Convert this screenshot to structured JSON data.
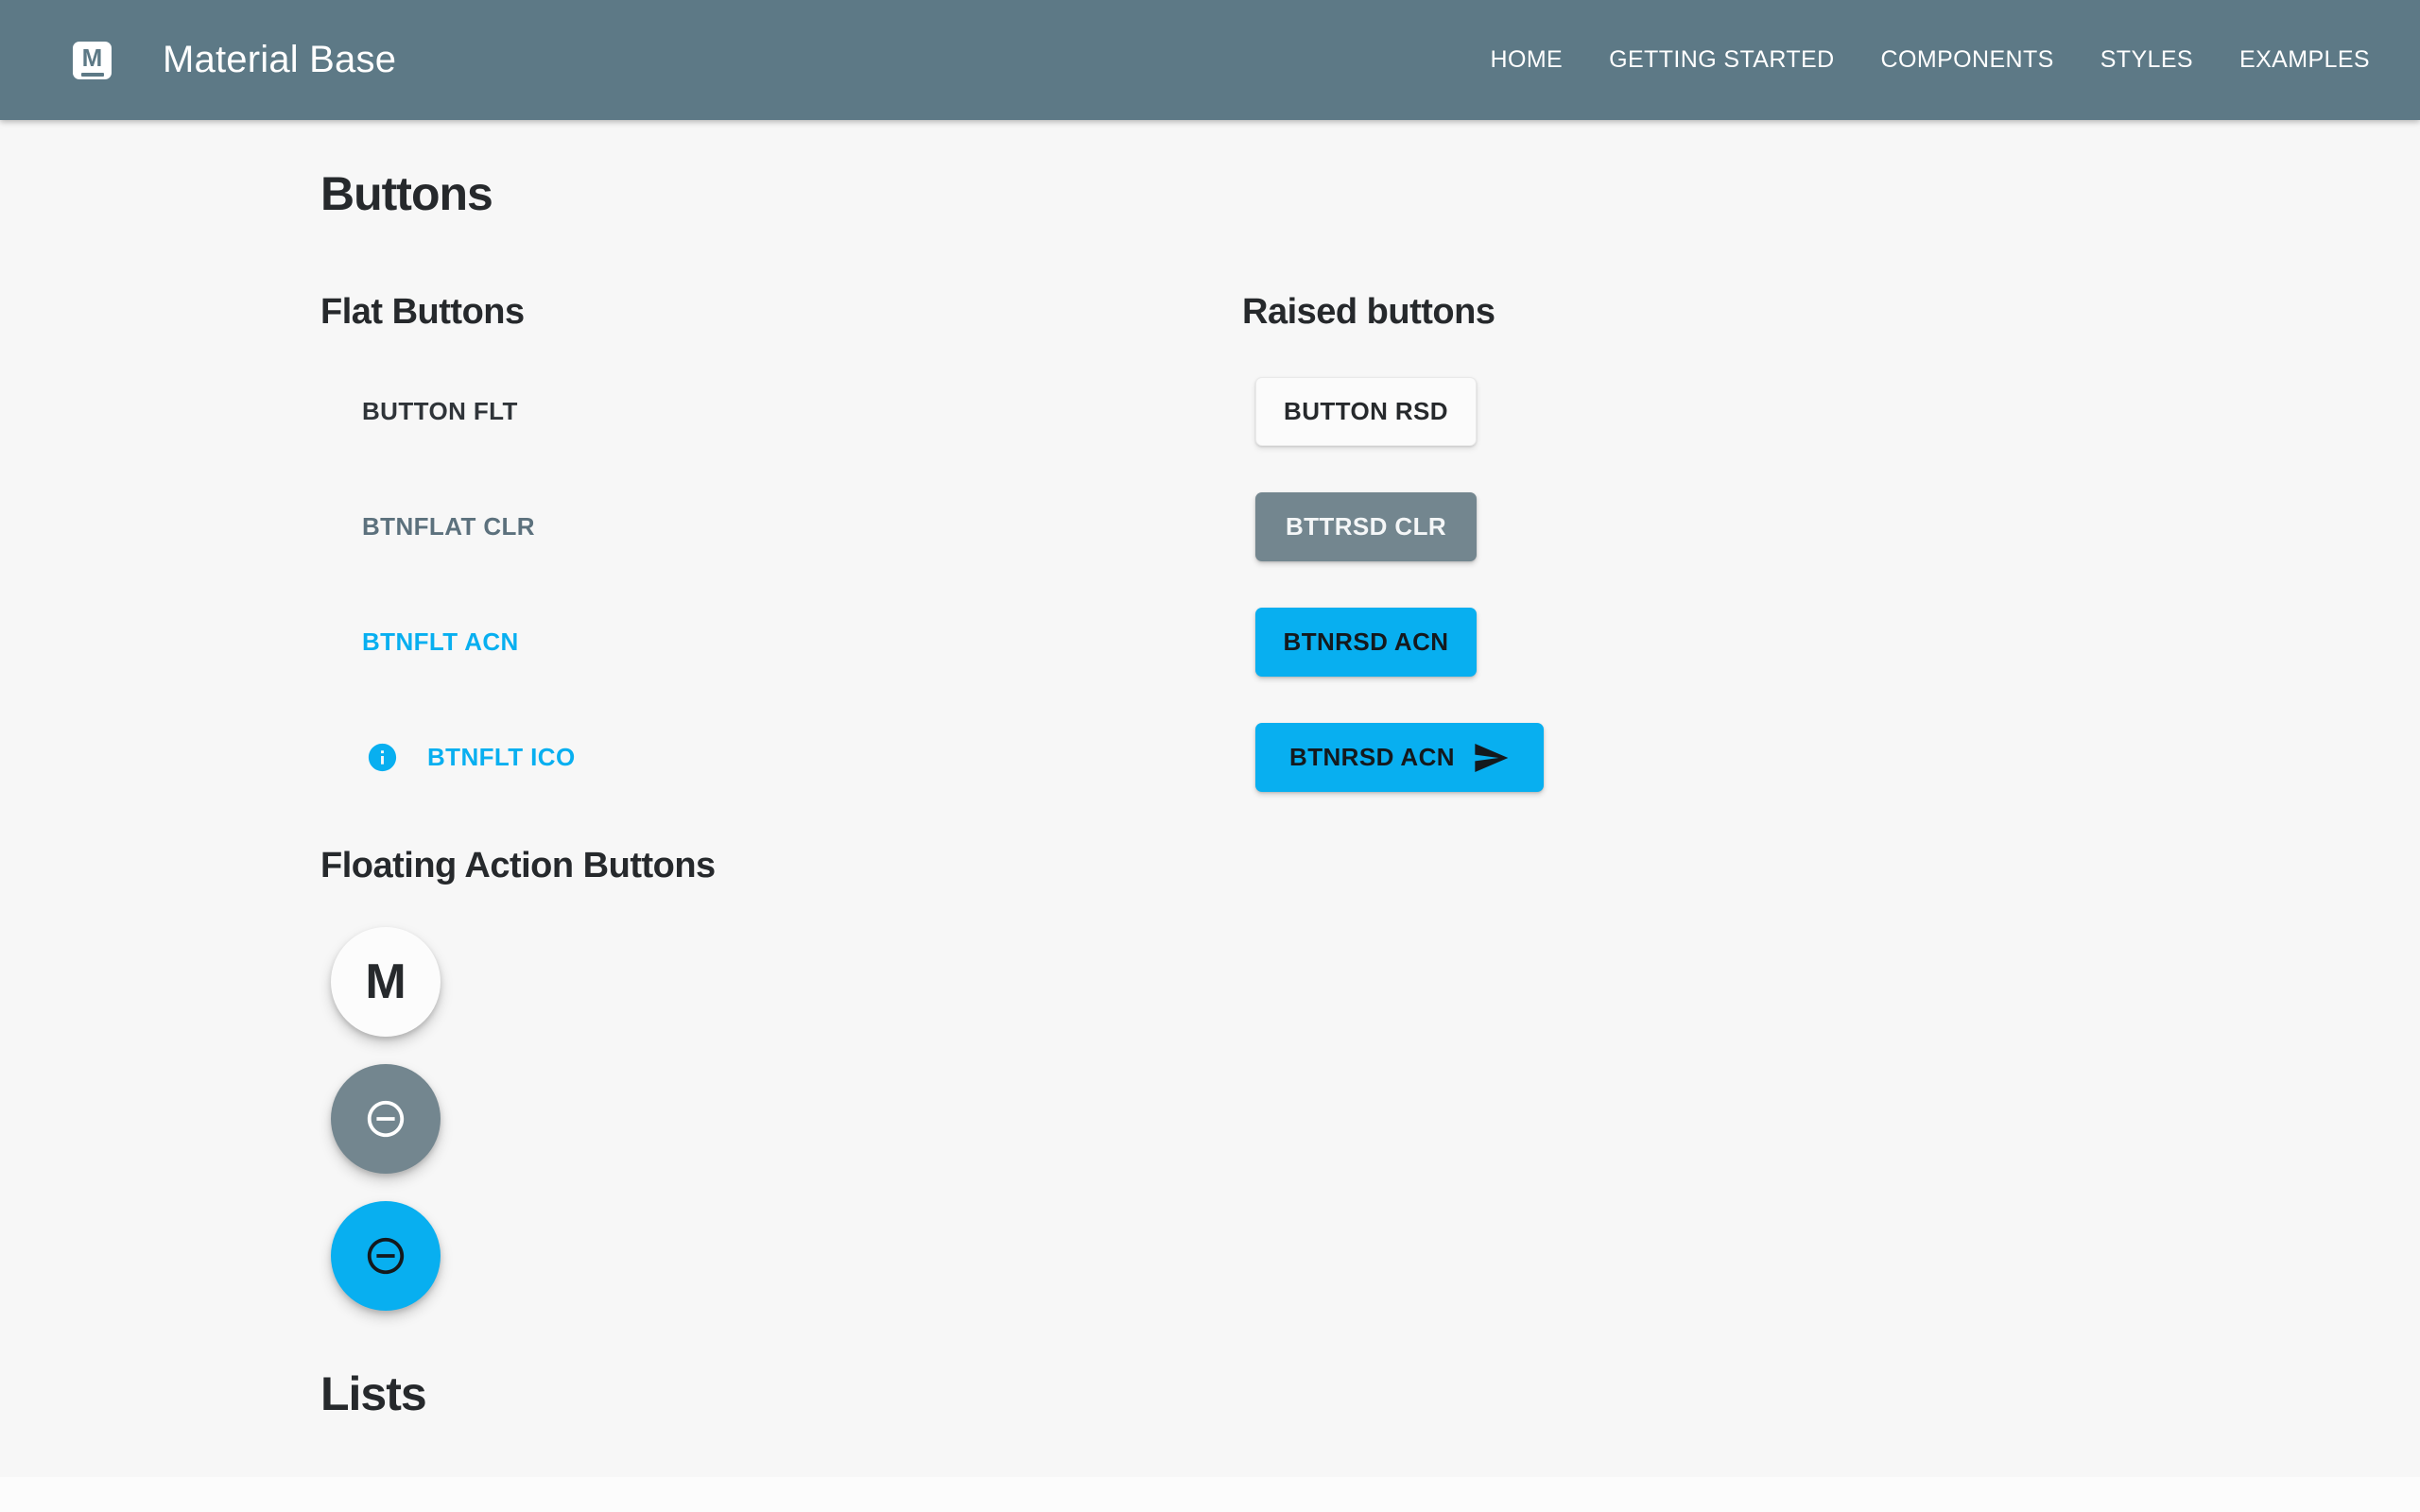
{
  "header": {
    "logo_letter": "M",
    "title": "Material Base",
    "nav": [
      {
        "label": "HOME"
      },
      {
        "label": "GETTING STARTED"
      },
      {
        "label": "COMPONENTS"
      },
      {
        "label": "STYLES"
      },
      {
        "label": "EXAMPLES"
      }
    ]
  },
  "sections": {
    "buttons": {
      "title": "Buttons",
      "flat": {
        "title": "Flat Buttons",
        "items": [
          {
            "label": "BUTTON FLT",
            "variant": "default"
          },
          {
            "label": "BTNFLAT CLR",
            "variant": "colored"
          },
          {
            "label": "BTNFLT ACN",
            "variant": "accent"
          },
          {
            "label": "BTNFLT ICO",
            "variant": "accent",
            "icon": "info-icon"
          }
        ]
      },
      "raised": {
        "title": "Raised buttons",
        "items": [
          {
            "label": "BUTTON RSD",
            "variant": "default"
          },
          {
            "label": "BTTRSD CLR",
            "variant": "colored"
          },
          {
            "label": "BTNRSD ACN",
            "variant": "accent"
          },
          {
            "label": "BTNRSD ACN",
            "variant": "accent",
            "icon": "send-icon"
          }
        ]
      }
    },
    "fab": {
      "title": "Floating Action Buttons",
      "items": [
        {
          "label": "M",
          "variant": "default"
        },
        {
          "variant": "colored",
          "icon": "remove-circle-outline-icon"
        },
        {
          "variant": "accent",
          "icon": "remove-circle-outline-icon"
        }
      ]
    },
    "lists": {
      "title": "Lists"
    }
  },
  "colors": {
    "header_bg": "#5D7986",
    "accent": "#08AFF0",
    "colored": "#73868F",
    "page_bg": "#F7F7F7",
    "text_dark": "#26292C"
  }
}
